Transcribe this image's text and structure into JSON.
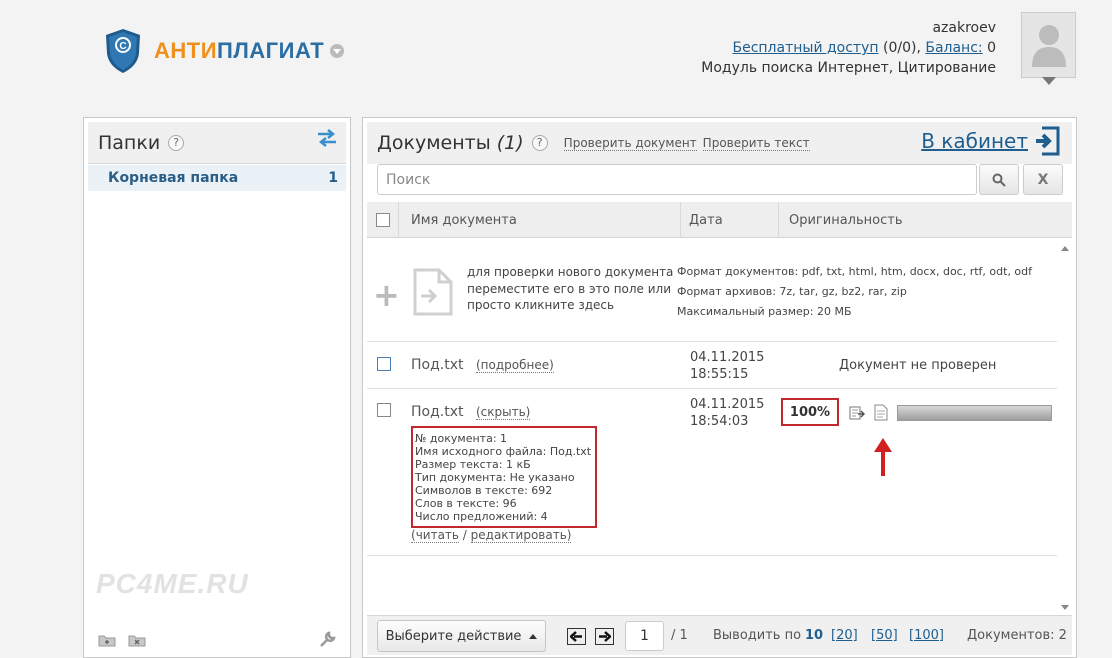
{
  "header": {
    "logo_part1": "АНТИ",
    "logo_part2": "ПЛАГИАТ",
    "username": "azakroev",
    "free_access_label": "Бесплатный доступ",
    "free_access_value": "(0/0),",
    "balance_label": "Баланс:",
    "balance_value": "0",
    "modules": "Модуль поиска Интернет, Цитирование"
  },
  "folders": {
    "title": "Папки",
    "help": "?",
    "root_label": "Корневая папка",
    "root_count": "1",
    "watermark": "PC4ME.RU"
  },
  "docs": {
    "title": "Документы",
    "count": "(1)",
    "help": "?",
    "check_doc": "Проверить документ",
    "check_text": "Проверить текст",
    "cabinet": "В кабинет",
    "search_placeholder": "Поиск",
    "clear_label": "X",
    "columns": {
      "name": "Имя документа",
      "date": "Дата",
      "originality": "Оригинальность"
    },
    "drop_hint": "для проверки нового документа переместите его в это поле или просто кликните здесь",
    "formats_docs": "Формат документов: pdf, txt, html, htm, docx, doc, rtf, odt, odf",
    "formats_archives": "Формат архивов: 7z, tar, gz, bz2, rar, zip",
    "max_size": "Максимальный размер: 20 МБ"
  },
  "rows": [
    {
      "name": "Под.txt",
      "toggle": "(подробнее)",
      "date": "04.11.2015",
      "time": "18:55:15",
      "status": "Документ не проверен"
    },
    {
      "name": "Под.txt",
      "toggle": "(скрыть)",
      "date": "04.11.2015",
      "time": "18:54:03",
      "originality": "100%",
      "progress": 1.0,
      "details": [
        "№ документа: 1",
        "Имя исходного файла: Под.txt",
        "Размер текста: 1 кБ",
        "Тип документа: Не указано",
        "Символов в тексте: 692",
        "Слов в тексте: 96",
        "Число предложений: 4"
      ],
      "read_label": "читать",
      "edit_label": "редактировать"
    }
  ],
  "bottom": {
    "action_label": "Выберите действие",
    "page_value": "1",
    "page_total": "/ 1",
    "per_page_label": "Выводить по",
    "per_page_current": "10",
    "per_page_opts": [
      "[20]",
      "[50]",
      "[100]"
    ],
    "docs_count_label": "Документов: 2"
  },
  "colors": {
    "accent_blue": "#1f5e8e",
    "logo_orange": "#f0901c",
    "highlight_red": "#c0282d"
  }
}
